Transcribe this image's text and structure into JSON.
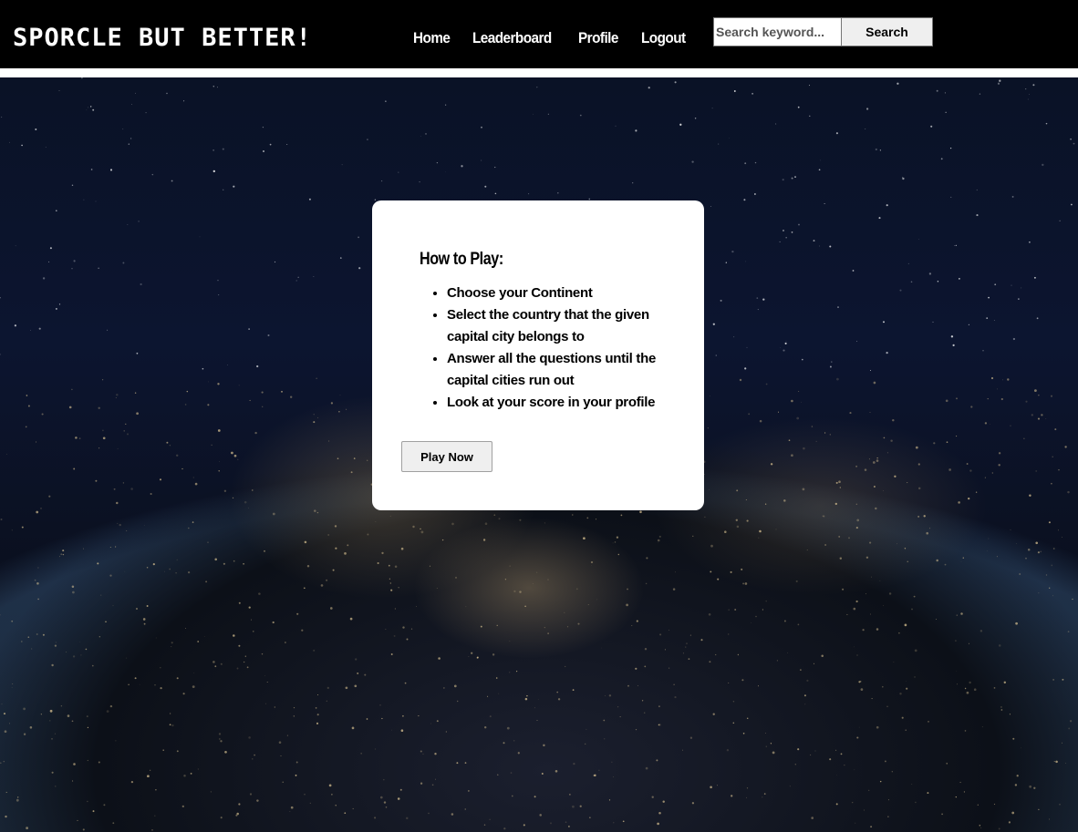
{
  "brand": "SPORCLE BUT BETTER!",
  "nav": {
    "links": [
      "Home",
      "Leaderboard",
      "Profile",
      "Logout"
    ]
  },
  "search": {
    "placeholder": "Search keyword...",
    "value": "",
    "button_label": "Search"
  },
  "instructions": {
    "title": "How to Play:",
    "steps": [
      "Choose your Continent",
      "Select the country that the given capital city belongs to",
      "Answer all the questions until the capital cities run out",
      "Look at your score in your profile"
    ],
    "play_button": "Play Now"
  },
  "colors": {
    "navbar_bg": "#000000",
    "nav_text": "#ffffff",
    "card_bg": "#ffffff",
    "button_bg": "#efefef"
  }
}
